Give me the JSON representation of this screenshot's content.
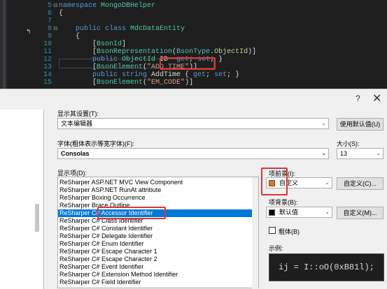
{
  "editor": {
    "lines": [
      {
        "n": "5",
        "txt": [
          {
            "c": "kw",
            "t": "namespace "
          },
          {
            "c": "ty",
            "t": "MongoDBHelper"
          }
        ],
        "fold": "⊟"
      },
      {
        "n": "6",
        "txt": [
          {
            "c": "pl",
            "t": "{"
          }
        ],
        "fold": ""
      },
      {
        "n": "7",
        "txt": [],
        "fold": ""
      },
      {
        "n": "8",
        "txt": [
          {
            "c": "pl",
            "t": "    "
          },
          {
            "c": "kw",
            "t": "public class "
          },
          {
            "c": "ty",
            "t": "MdcDataEntity"
          }
        ],
        "fold": "⊟"
      },
      {
        "n": "9",
        "txt": [
          {
            "c": "pl",
            "t": "    {"
          }
        ],
        "fold": ""
      },
      {
        "n": "10",
        "txt": [
          {
            "c": "pl",
            "t": "        ["
          },
          {
            "c": "ty",
            "t": "BsonId"
          },
          {
            "c": "pl",
            "t": "]"
          }
        ],
        "fold": ""
      },
      {
        "n": "11",
        "txt": [
          {
            "c": "pl",
            "t": "        ["
          },
          {
            "c": "ty",
            "t": "BsonRepresentation"
          },
          {
            "c": "pl",
            "t": "("
          },
          {
            "c": "ty",
            "t": "BsonType"
          },
          {
            "c": "pl",
            "t": "."
          },
          {
            "c": "pu",
            "t": "ObjectId"
          },
          {
            "c": "pl",
            "t": ")]"
          }
        ],
        "fold": ""
      },
      {
        "n": "12",
        "txt": [
          {
            "c": "pl",
            "t": "        "
          },
          {
            "c": "kw",
            "t": "public "
          },
          {
            "c": "ty",
            "t": "ObjectId "
          },
          {
            "c": "pl",
            "t": "ID  "
          },
          {
            "c": "kw",
            "t": "get"
          },
          {
            "c": "pl",
            "t": "; "
          },
          {
            "c": "kw",
            "t": "set"
          },
          {
            "c": "pl",
            "t": "; }"
          }
        ],
        "fold": ""
      },
      {
        "n": "13",
        "txt": [
          {
            "c": "pl",
            "t": "        ["
          },
          {
            "c": "ty",
            "t": "BsonElement"
          },
          {
            "c": "pl",
            "t": "("
          },
          {
            "c": "st",
            "t": "\"ADD_TIME\""
          },
          {
            "c": "pl",
            "t": ")]"
          }
        ],
        "fold": ""
      },
      {
        "n": "14",
        "txt": [
          {
            "c": "pl",
            "t": "        "
          },
          {
            "c": "kw",
            "t": "public string "
          },
          {
            "c": "pl",
            "t": "AddTime { "
          },
          {
            "c": "kw",
            "t": "get"
          },
          {
            "c": "pl",
            "t": "; "
          },
          {
            "c": "kw",
            "t": "set"
          },
          {
            "c": "pl",
            "t": "; }"
          }
        ],
        "fold": ""
      },
      {
        "n": "15",
        "txt": [
          {
            "c": "pl",
            "t": "        ["
          },
          {
            "c": "ty",
            "t": "BsonElement"
          },
          {
            "c": "pl",
            "t": "("
          },
          {
            "c": "st",
            "t": "\"EM_CODE\""
          },
          {
            "c": "pl",
            "t": ")]"
          }
        ],
        "fold": ""
      }
    ]
  },
  "dialog": {
    "help": "?",
    "close": "✕",
    "show_settings_label": "显示其设置(T):",
    "show_settings_value": "文本编辑器",
    "use_defaults_button": "使用默认值(U)",
    "font_label": "字体(粗体表示等宽字体)(F):",
    "font_value": "Consolas",
    "size_label": "大小(S):",
    "size_value": "13",
    "display_items_label": "显示项(D):",
    "display_items": [
      "ReSharper ASP.NET MVC View Component",
      "ReSharper ASP.NET RunAt attribute",
      "ReSharper Boxing Occurrence",
      "ReSharper Brace Outline",
      "ReSharper C# Accessor Identifier",
      "ReSharper C# Class Identifier",
      "ReSharper C# Constant Identifier",
      "ReSharper C# Delegate Identifier",
      "ReSharper C# Enum Identifier",
      "ReSharper C# Escape Character 1",
      "ReSharper C# Escape Character 2",
      "ReSharper C# Event Identifier",
      "ReSharper C# Extension Method Identifier",
      "ReSharper C# Field Identifier"
    ],
    "selected_index": 4,
    "foreground_label": "项前景(I):",
    "foreground_value": "自定义",
    "foreground_color": "#e8751a",
    "foreground_custom_button": "自定义(C)...",
    "background_label": "项背景(B):",
    "background_value": "默认值",
    "background_color": "#000000",
    "background_custom_button": "自定义(M)...",
    "bold_label": "粗体(B)",
    "sample_label": "示例:",
    "sample_text": "ij = I::oO(0xB81l);"
  }
}
